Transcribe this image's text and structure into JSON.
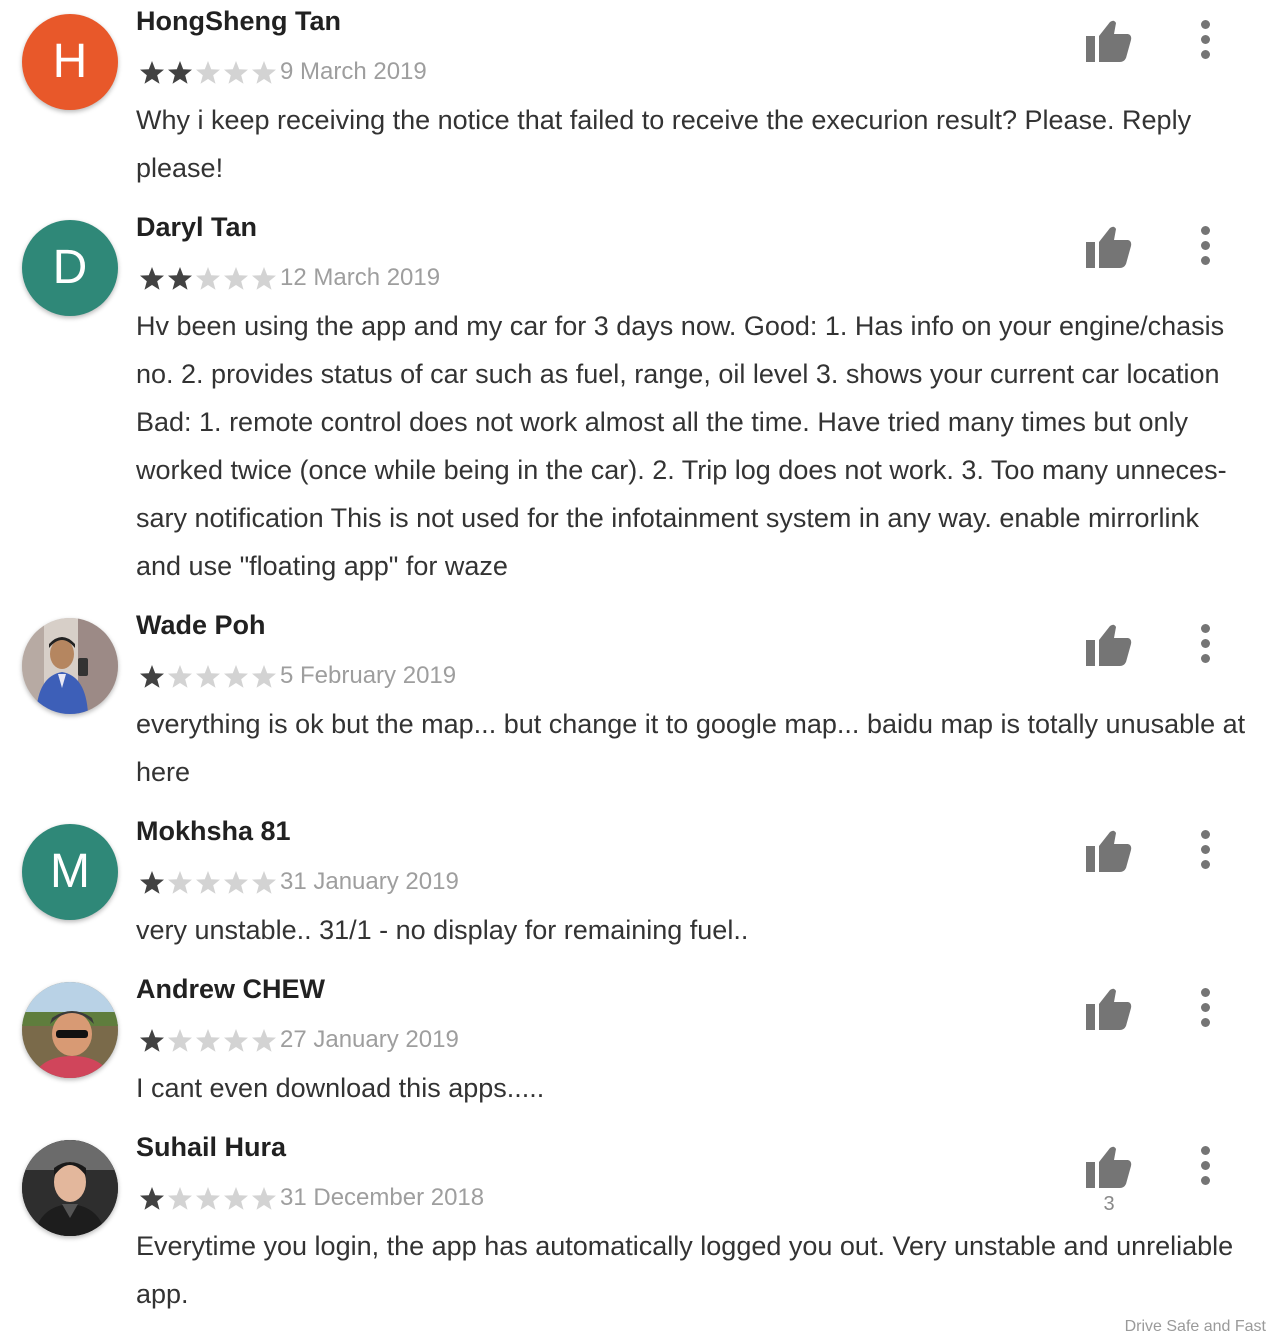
{
  "colors": {
    "star_filled": "#424242",
    "star_empty": "#d3d3d3",
    "thumb": "#757575",
    "avatar_h": "#e8582a",
    "avatar_d": "#2f8878",
    "avatar_m": "#2f8878"
  },
  "reviews": [
    {
      "name": "HongSheng Tan",
      "avatar_letter": "H",
      "rating": 2,
      "date": "9 March 2019",
      "text": "Why i keep receiving the notice that failed to receive the execurion result? Please. Reply please!"
    },
    {
      "name": "Daryl Tan",
      "avatar_letter": "D",
      "rating": 2,
      "date": "12 March 2019",
      "text": "Hv been using the app and my car for 3 days now. Good: 1. Has info on your engine/chasis no. 2. provides status of car such as fuel, range, oil level 3. shows your current car location Bad: 1. remote control does not work almost all the time. Have tried many times but only worked twice (once while being in the car). 2. Trip log does not work. 3. Too many unneces-sary notification This is not used for the infotainment system in any way. enable mirrorlink and use \"floating app\" for waze"
    },
    {
      "name": "Wade Poh",
      "avatar_letter": "",
      "rating": 1,
      "date": "5 February 2019",
      "text": "everything is ok but the map... but change it to google map... baidu map is totally unusable at here"
    },
    {
      "name": "Mokhsha 81",
      "avatar_letter": "M",
      "rating": 1,
      "date": "31 January 2019",
      "text": "very unstable.. 31/1 - no display for remaining fuel.."
    },
    {
      "name": "Andrew CHEW",
      "avatar_letter": "",
      "rating": 1,
      "date": "27 January 2019",
      "text": "I cant even download this apps....."
    },
    {
      "name": "Suhail Hura",
      "avatar_letter": "",
      "rating": 1,
      "date": "31 December 2018",
      "text": "Everytime you login, the app has automatically logged you out. Very unstable and unreliable app.",
      "helpful_count": "3"
    }
  ],
  "watermark": "Drive Safe and Fast"
}
